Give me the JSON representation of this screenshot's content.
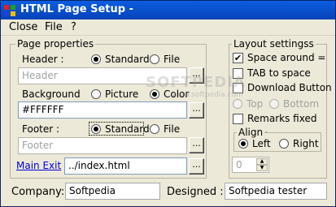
{
  "window": {
    "title": "HTML Page Setup -"
  },
  "menu": {
    "close": "Close",
    "file": "File",
    "help": "?"
  },
  "page_properties": {
    "group_label": "Page properties",
    "header": {
      "label": "Header :",
      "opt_standard": "Standard",
      "opt_file": "File",
      "selected": "Standard",
      "placeholder": "Header"
    },
    "background": {
      "label": "Background",
      "opt_picture": "Picture",
      "opt_color": "Color",
      "selected": "Color",
      "value": "#FFFFFF"
    },
    "footer": {
      "label": "Footer :",
      "opt_standard": "Standard",
      "opt_file": "File",
      "selected": "Standard",
      "placeholder": "Footer"
    },
    "main_exit": {
      "link": "Main Exit",
      "value": "../index.html"
    },
    "browse": "..."
  },
  "layout_settings": {
    "group_label": "Layout settingss",
    "space_around": {
      "label": "Space around =",
      "checked": true
    },
    "tab_to_space": {
      "label": "TAB to space",
      "checked": false
    },
    "download_button": {
      "label": "Download Button",
      "checked": false
    },
    "top": "Top",
    "bottom": "Bottom",
    "remarks_fixed": {
      "label": "Remarks fixed pos.",
      "checked": false
    },
    "align": {
      "label": "Align",
      "left": "Left",
      "right": "Right",
      "selected": "Left"
    },
    "spinner_value": "0"
  },
  "footer_fields": {
    "company_label": "Company:",
    "company_value": "Softpedia",
    "designed_label": "Designed :",
    "designed_value": "Softpedia tester"
  },
  "watermark": {
    "main": "SOFTPEDIA",
    "sub": "www.softpedia.com"
  }
}
